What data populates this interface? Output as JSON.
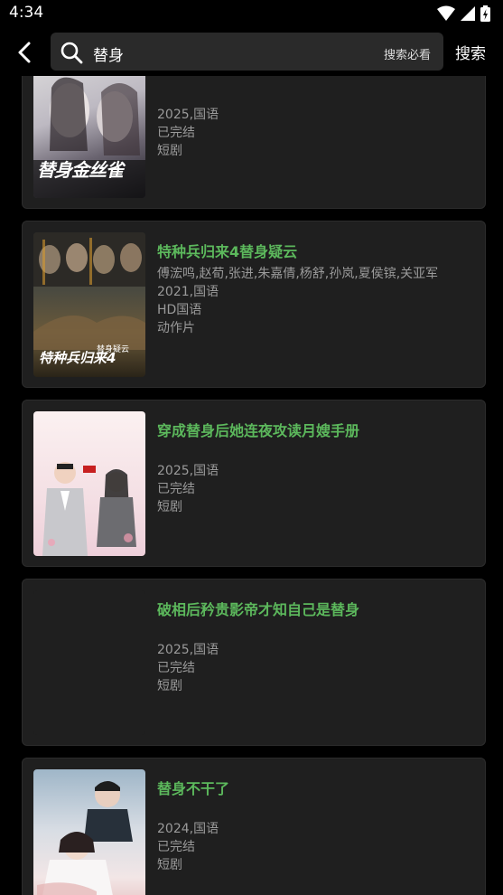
{
  "status_bar": {
    "time": "4:34"
  },
  "header": {
    "search_value": "替身",
    "search_hint": "搜索必看",
    "search_button": "搜索"
  },
  "results": [
    {
      "poster_text": "替身金丝雀",
      "title": "",
      "actors": "",
      "year_lang": "2025,国语",
      "status": "已完结",
      "genre": "短剧"
    },
    {
      "poster_text": "特种兵归来4",
      "poster_sub": "替身疑云",
      "title": "特种兵归来4替身疑云",
      "actors": "傅浤鸣,赵荀,张进,朱嘉倩,杨舒,孙岚,夏侯镔,关亚军",
      "year_lang": "2021,国语",
      "status": "HD国语",
      "genre": "动作片"
    },
    {
      "title": "穿成替身后她连夜攻读月嫂手册",
      "actors": "",
      "year_lang": "2025,国语",
      "status": "已完结",
      "genre": "短剧"
    },
    {
      "title": "破相后矜贵影帝才知自己是替身",
      "actors": "",
      "year_lang": "2025,国语",
      "status": "已完结",
      "genre": "短剧"
    },
    {
      "title": "替身不干了",
      "actors": "",
      "year_lang": "2024,国语",
      "status": "已完结",
      "genre": "短剧"
    }
  ],
  "colors": {
    "accent": "#5cb85c",
    "card_bg": "#1f1f1f",
    "page_bg": "#000000"
  }
}
